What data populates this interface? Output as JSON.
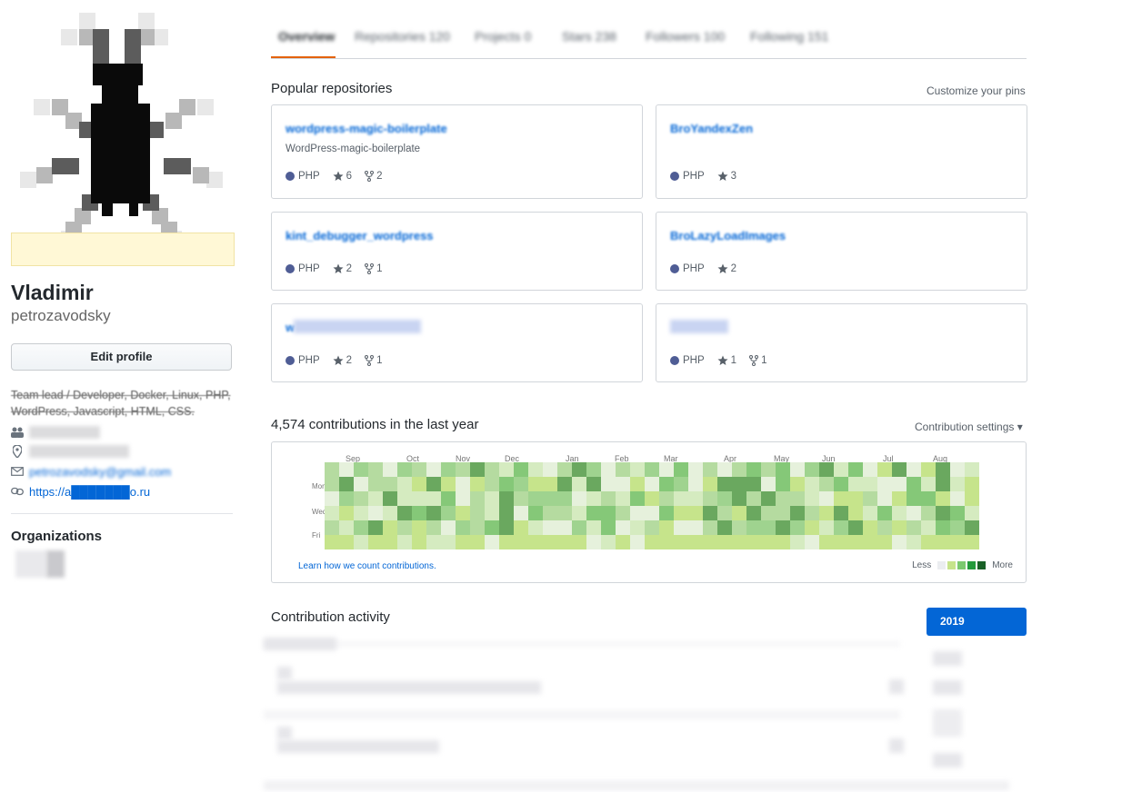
{
  "profile": {
    "full_name": "Vladimir",
    "username": "petrozavodsky",
    "edit_button": "Edit profile",
    "bio": "Team lead / Developer, Docker, Linux, PHP, WordPress, Javascript, HTML, CSS.",
    "email": "petrozavodsky@gmail.com",
    "website": "https://a███████o.ru",
    "organizations_title": "Organizations"
  },
  "tabs": [
    {
      "label": "Overview",
      "selected": true
    },
    {
      "label": "Repositories 120"
    },
    {
      "label": "Projects 0"
    },
    {
      "label": "Stars 238"
    },
    {
      "label": "Followers 100"
    },
    {
      "label": "Following 151"
    }
  ],
  "pinned": {
    "title": "Popular repositories",
    "customize_link": "Customize your pins",
    "repos": [
      {
        "name": "wordpress-magic-boilerplate",
        "description": "WordPress-magic-boilerplate",
        "language": "PHP",
        "stars": "6",
        "forks": "2"
      },
      {
        "name": "BroYandexZen",
        "description": "",
        "language": "PHP",
        "stars": "3",
        "forks": ""
      },
      {
        "name": "kint_debugger_wordpress",
        "description": "",
        "language": "PHP",
        "stars": "2",
        "forks": "1"
      },
      {
        "name": "BroLazyLoadImages",
        "description": "",
        "language": "PHP",
        "stars": "2",
        "forks": ""
      },
      {
        "name": "w",
        "description": "",
        "language": "PHP",
        "stars": "2",
        "forks": "1"
      },
      {
        "name": "",
        "description": "",
        "language": "PHP",
        "stars": "1",
        "forks": "1"
      }
    ]
  },
  "contributions": {
    "title": "4,574 contributions in the last year",
    "settings": "Contribution settings ▾",
    "months": [
      "Sep",
      "Oct",
      "Nov",
      "Dec",
      "Jan",
      "Feb",
      "Mar",
      "Apr",
      "May",
      "Jun",
      "Jul",
      "Aug"
    ],
    "days": [
      "Mon",
      "Wed",
      "Fri"
    ],
    "learn_link": "Learn how we count contributions.",
    "legend_less": "Less",
    "legend_more": "More",
    "colors": [
      "#ebedf0",
      "#c6e48b",
      "#7bc96f",
      "#239a3b",
      "#196127"
    ]
  },
  "activity": {
    "title": "Contribution activity",
    "year_button": "2019"
  },
  "icons": {
    "people": "people-icon",
    "location": "location-icon",
    "mail": "mail-icon",
    "link": "link-icon",
    "star": "star-icon",
    "fork": "fork-icon"
  }
}
